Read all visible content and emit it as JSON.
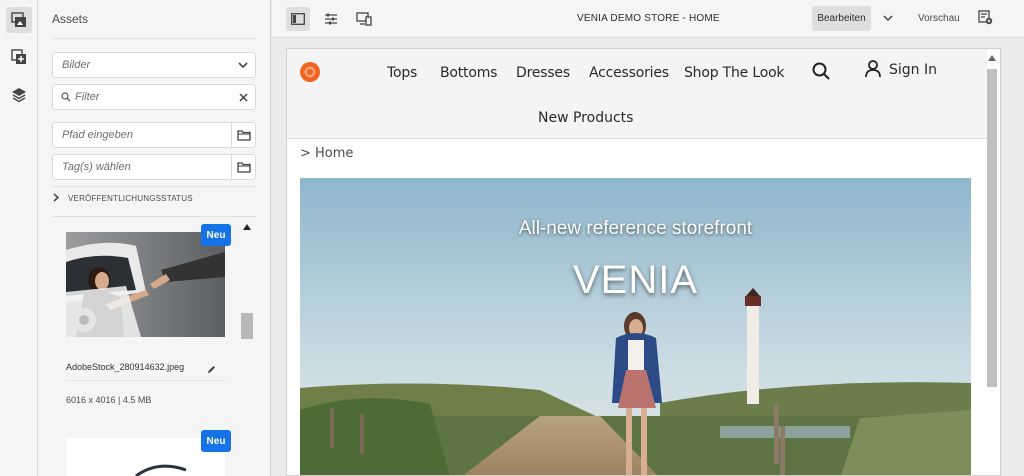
{
  "assets_panel": {
    "title": "Assets",
    "asset_type_select": "Bilder",
    "filter_placeholder": "Filter",
    "path_placeholder": "Pfad eingeben",
    "tags_placeholder": "Tag(s) wählen",
    "publication_status_label": "VERÖFFENTLICHUNGSSTATUS",
    "items": [
      {
        "badge": "Neu",
        "name": "AdobeStock_280914632.jpeg",
        "meta": "6016 x 4016 | 4.5 MB"
      },
      {
        "badge": "Neu"
      }
    ]
  },
  "toolbar": {
    "page_title": "VENIA DEMO STORE - HOME",
    "edit_mode": "Bearbeiten",
    "preview_mode": "Vorschau"
  },
  "site": {
    "nav": [
      "Tops",
      "Bottoms",
      "Dresses",
      "Accessories",
      "Shop The Look"
    ],
    "nav_second_row": "New Products",
    "sign_in": "Sign In",
    "breadcrumb": "> Home",
    "hero": {
      "subtitle": "All-new reference storefront",
      "title": "VENIA"
    }
  },
  "colors": {
    "accent_blue": "#1473e6",
    "logo_orange": "#f26322"
  }
}
